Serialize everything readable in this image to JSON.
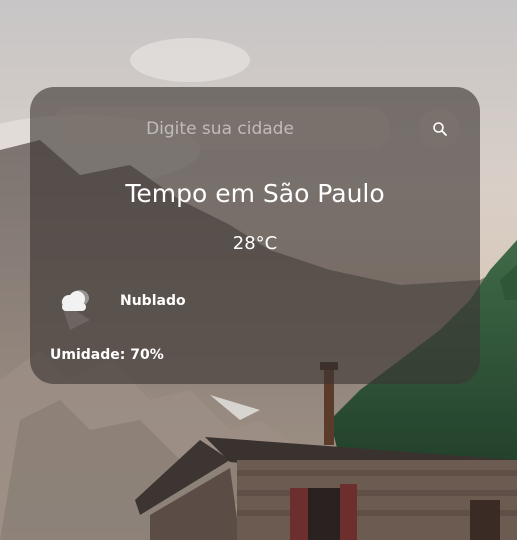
{
  "search": {
    "placeholder": "Digite sua cidade",
    "value": ""
  },
  "weather": {
    "title": "Tempo em São Paulo",
    "temperature": "28°C",
    "description": "Nublado",
    "humidity": "Umidade: 70%",
    "icon": "cloud-icon"
  },
  "background": {
    "icon": "mountain-landscape-photo"
  }
}
